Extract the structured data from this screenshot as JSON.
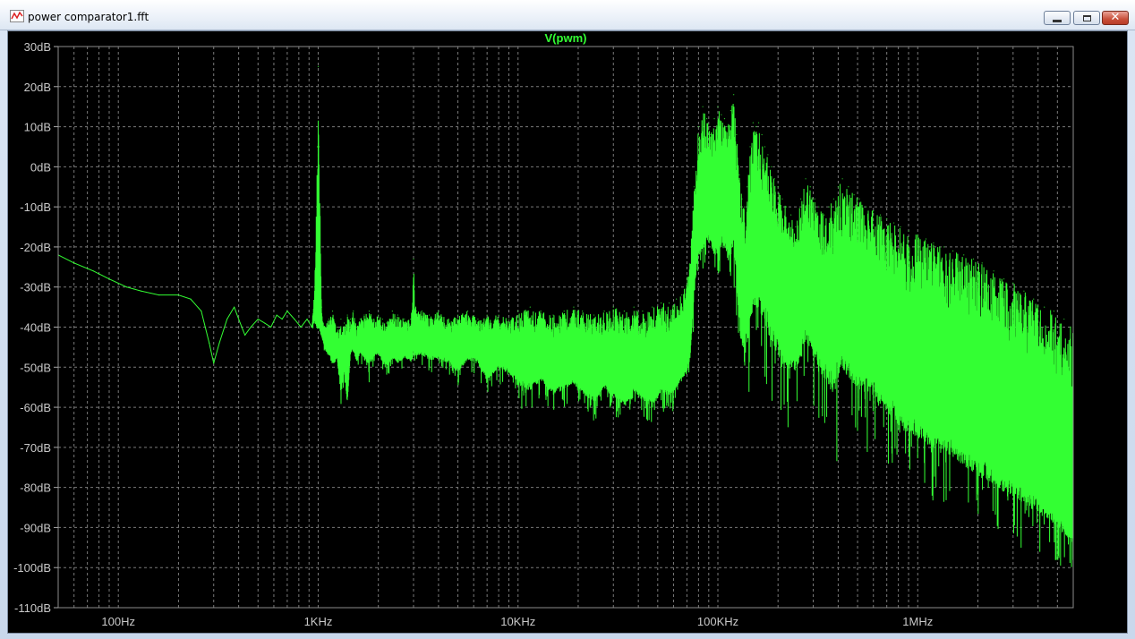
{
  "window": {
    "title": "power comparator1.fft",
    "icon": "waveform-icon",
    "minimize_icon": "minimize-icon",
    "maximize_icon": "maximize-icon",
    "close_icon": "close-icon",
    "close_glyph": "✕"
  },
  "colors": {
    "trace": "#33ff33",
    "background": "#000000",
    "grid": "#7a7a7a",
    "axis_text": "#c8c8c8"
  },
  "chart_data": {
    "type": "line",
    "title": "V(pwm)",
    "xlabel": "",
    "ylabel": "",
    "x_scale": "log",
    "xlim": [
      50,
      6000000
    ],
    "ylim": [
      -110,
      30
    ],
    "grid": true,
    "x_ticks": [
      {
        "value": 100,
        "label": "100Hz"
      },
      {
        "value": 1000,
        "label": "1KHz"
      },
      {
        "value": 10000,
        "label": "10KHz"
      },
      {
        "value": 100000,
        "label": "100KHz"
      },
      {
        "value": 1000000,
        "label": "1MHz"
      }
    ],
    "y_ticks": [
      {
        "value": 30,
        "label": "30dB"
      },
      {
        "value": 20,
        "label": "20dB"
      },
      {
        "value": 10,
        "label": "10dB"
      },
      {
        "value": 0,
        "label": "0dB"
      },
      {
        "value": -10,
        "label": "-10dB"
      },
      {
        "value": -20,
        "label": "-20dB"
      },
      {
        "value": -30,
        "label": "-30dB"
      },
      {
        "value": -40,
        "label": "-40dB"
      },
      {
        "value": -50,
        "label": "-50dB"
      },
      {
        "value": -60,
        "label": "-60dB"
      },
      {
        "value": -70,
        "label": "-70dB"
      },
      {
        "value": -80,
        "label": "-80dB"
      },
      {
        "value": -90,
        "label": "-90dB"
      },
      {
        "value": -100,
        "label": "-100dB"
      },
      {
        "value": -110,
        "label": "-110dB"
      }
    ],
    "series": [
      {
        "name": "V(pwm)",
        "x": [
          50,
          60,
          75,
          90,
          110,
          130,
          160,
          200,
          230,
          260,
          285,
          300,
          320,
          350,
          380,
          400,
          430,
          460,
          500,
          540,
          580,
          620,
          660,
          700,
          760,
          820,
          880,
          930,
          960,
          990,
          1000,
          1010,
          1040,
          1080,
          1130,
          1180,
          1240,
          1300,
          1350,
          1400,
          1450,
          1500,
          1560,
          1620,
          1700,
          1800,
          1900,
          2000,
          2100,
          2200,
          2350,
          2500,
          2700,
          2900,
          2980,
          3000,
          3020,
          3100,
          3300,
          3600,
          4000,
          4500,
          5000,
          5600,
          6300,
          7000,
          8000,
          9000,
          10000,
          11500,
          13000,
          15000,
          17000,
          19000,
          21000,
          24000,
          27000,
          30000,
          34000,
          38000,
          42000,
          47000,
          52000,
          57000,
          62000,
          66000,
          70000,
          73000,
          76000,
          80000,
          84000,
          88000,
          92000,
          96000,
          100000,
          104000,
          108000,
          112000,
          116000,
          120000,
          124000,
          128000,
          132000,
          136000,
          140000,
          145000,
          150000,
          155000,
          160000,
          166000,
          172000,
          178000,
          185000,
          192000,
          200000,
          210000,
          220000,
          232000,
          245000,
          260000,
          275000,
          290000,
          305000,
          320000,
          340000,
          360000,
          380000,
          400000,
          420000,
          450000,
          480000,
          510000,
          550000,
          600000,
          650000,
          700000,
          760000,
          820000,
          900000,
          1000000,
          1100000,
          1200000,
          1350000,
          1500000,
          1700000,
          1900000,
          2100000,
          2400000,
          2700000,
          3000000,
          3400000,
          3800000,
          4300000,
          4800000,
          5400000,
          6000000
        ],
        "y_upper": [
          -22,
          -24,
          -26,
          -28,
          -30,
          -31,
          -32,
          -32,
          -33,
          -36,
          -44,
          -49,
          -44,
          -38,
          -35,
          -38,
          -42,
          -40,
          -38,
          -39,
          -40,
          -37,
          -38,
          -36,
          -38,
          -40,
          -38,
          -40,
          -30,
          5,
          25,
          5,
          -35,
          -40,
          -38,
          -36,
          -40,
          -38,
          -39,
          -37,
          -38,
          -36,
          -40,
          -38,
          -37,
          -36,
          -38,
          -37,
          -38,
          -39,
          -36,
          -37,
          -38,
          -38,
          -30,
          -23,
          -30,
          -36,
          -36,
          -37,
          -36,
          -38,
          -37,
          -36,
          -38,
          -37,
          -37,
          -38,
          -36,
          -35,
          -36,
          -37,
          -36,
          -35,
          -36,
          -37,
          -36,
          -35,
          -36,
          -35,
          -36,
          -35,
          -34,
          -34,
          -33,
          -32,
          -28,
          -20,
          -5,
          10,
          15,
          12,
          8,
          12,
          15,
          13,
          12,
          10,
          14,
          18,
          8,
          -2,
          -8,
          -10,
          -5,
          5,
          11,
          10,
          11,
          8,
          5,
          3,
          0,
          -3,
          -5,
          -8,
          -10,
          -12,
          -15,
          -8,
          -3,
          -5,
          -8,
          -10,
          -12,
          -10,
          -8,
          -5,
          -3,
          -5,
          -7,
          -8,
          -10,
          -11,
          -12,
          -13,
          -14,
          -15,
          -16,
          -17,
          -18,
          -19,
          -20,
          -21,
          -22,
          -23,
          -24,
          -26,
          -28,
          -29,
          -31,
          -33,
          -35,
          -36,
          -38,
          -40,
          -42,
          -44
        ],
        "y_lower": [
          -22,
          -24,
          -26,
          -28,
          -30,
          -31,
          -32,
          -32,
          -33,
          -36,
          -44,
          -49,
          -44,
          -38,
          -35,
          -38,
          -42,
          -40,
          -38,
          -39,
          -40,
          -37,
          -38,
          -36,
          -38,
          -40,
          -38,
          -40,
          -38,
          -40,
          -40,
          -40,
          -42,
          -45,
          -46,
          -48,
          -47,
          -55,
          -50,
          -60,
          -46,
          -45,
          -48,
          -46,
          -47,
          -48,
          -47,
          -46,
          -48,
          -49,
          -47,
          -48,
          -47,
          -48,
          -47,
          -45,
          -47,
          -46,
          -46,
          -47,
          -47,
          -48,
          -50,
          -47,
          -48,
          -52,
          -49,
          -50,
          -53,
          -54,
          -52,
          -55,
          -54,
          -53,
          -55,
          -57,
          -54,
          -56,
          -58,
          -55,
          -57,
          -58,
          -55,
          -56,
          -54,
          -52,
          -50,
          -45,
          -30,
          -20,
          -20,
          -16,
          -18,
          -20,
          -20,
          -17,
          -18,
          -20,
          -20,
          -16,
          -25,
          -35,
          -40,
          -42,
          -40,
          -35,
          -30,
          -30,
          -31,
          -33,
          -34,
          -36,
          -38,
          -40,
          -42,
          -44,
          -46,
          -46,
          -48,
          -44,
          -40,
          -42,
          -44,
          -46,
          -48,
          -50,
          -48,
          -47,
          -46,
          -48,
          -50,
          -51,
          -52,
          -53,
          -55,
          -57,
          -58,
          -60,
          -62,
          -63,
          -64,
          -65,
          -66,
          -68,
          -70,
          -72,
          -73,
          -75,
          -77,
          -78,
          -80,
          -82,
          -84,
          -86,
          -89,
          -92
        ],
        "y_min": [
          -22,
          -24,
          -26,
          -28,
          -30,
          -31,
          -32,
          -32,
          -33,
          -36,
          -44,
          -49,
          -44,
          -38,
          -35,
          -38,
          -42,
          -40,
          -38,
          -39,
          -40,
          -37,
          -38,
          -36,
          -38,
          -40,
          -38,
          -40,
          -42,
          -42,
          -42,
          -42,
          -44,
          -48,
          -50,
          -54,
          -52,
          -61,
          -55,
          -52,
          -50,
          -49,
          -51,
          -50,
          -52,
          -54,
          -50,
          -49,
          -52,
          -53,
          -50,
          -52,
          -50,
          -52,
          -50,
          -48,
          -50,
          -50,
          -50,
          -52,
          -51,
          -53,
          -55,
          -52,
          -53,
          -58,
          -54,
          -56,
          -60,
          -62,
          -58,
          -62,
          -60,
          -58,
          -61,
          -64,
          -60,
          -62,
          -64,
          -61,
          -63,
          -64,
          -61,
          -62,
          -60,
          -58,
          -56,
          -50,
          -40,
          -28,
          -26,
          -24,
          -26,
          -28,
          -28,
          -25,
          -26,
          -28,
          -30,
          -30,
          -40,
          -55,
          -62,
          -65,
          -60,
          -55,
          -50,
          -48,
          -50,
          -52,
          -55,
          -58,
          -60,
          -62,
          -64,
          -66,
          -68,
          -62,
          -60,
          -58,
          -55,
          -58,
          -62,
          -64,
          -66,
          -72,
          -85,
          -70,
          -64,
          -66,
          -68,
          -70,
          -71,
          -72,
          -74,
          -76,
          -78,
          -80,
          -82,
          -82,
          -84,
          -86,
          -85,
          -86,
          -88,
          -90,
          -92,
          -93,
          -94,
          -95,
          -96,
          -97,
          -98,
          -99,
          -100,
          -100
        ]
      }
    ]
  }
}
